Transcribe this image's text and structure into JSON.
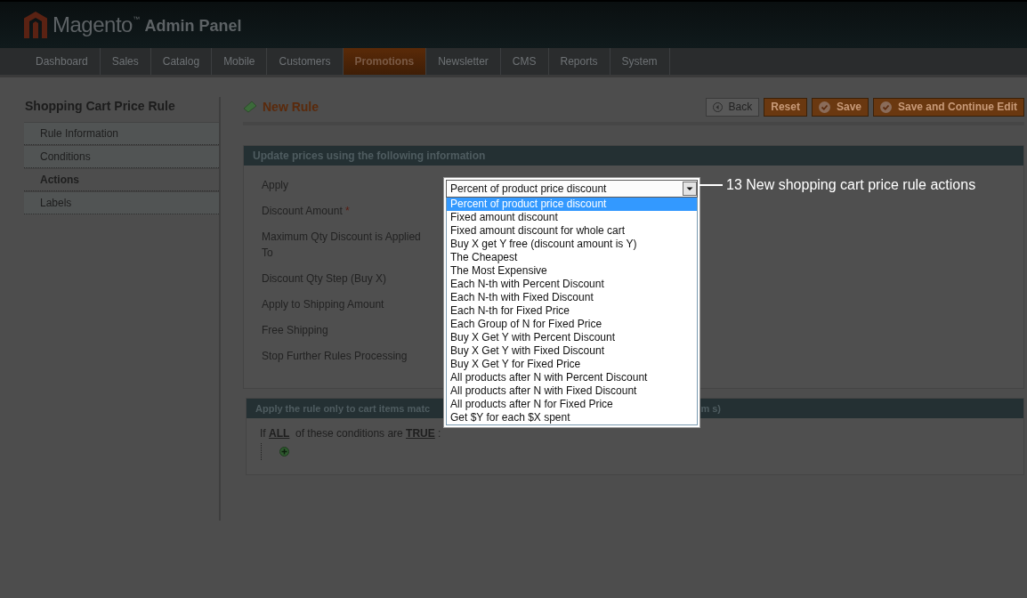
{
  "header": {
    "logo": "Magento",
    "trademark": "™",
    "subtitle": "Admin Panel"
  },
  "nav": [
    {
      "label": "Dashboard",
      "selected": false
    },
    {
      "label": "Sales",
      "selected": false
    },
    {
      "label": "Catalog",
      "selected": false
    },
    {
      "label": "Mobile",
      "selected": false
    },
    {
      "label": "Customers",
      "selected": false
    },
    {
      "label": "Promotions",
      "selected": true
    },
    {
      "label": "Newsletter",
      "selected": false
    },
    {
      "label": "CMS",
      "selected": false
    },
    {
      "label": "Reports",
      "selected": false
    },
    {
      "label": "System",
      "selected": false
    }
  ],
  "sidebar": {
    "title": "Shopping Cart Price Rule",
    "tabs": [
      {
        "label": "Rule Information",
        "selected": false
      },
      {
        "label": "Conditions",
        "selected": false
      },
      {
        "label": "Actions",
        "selected": true
      },
      {
        "label": "Labels",
        "selected": false
      }
    ]
  },
  "page_title": "New Rule",
  "buttons": [
    {
      "label": "Back",
      "kind": "back"
    },
    {
      "label": "Reset",
      "kind": "reset"
    },
    {
      "label": "Save",
      "kind": "save"
    },
    {
      "label": "Save and Continue Edit",
      "kind": "save"
    }
  ],
  "actions_section": {
    "title": "Update prices using the following information",
    "fields": [
      {
        "label": "Apply"
      },
      {
        "label": "Discount Amount",
        "required_mark": "*"
      },
      {
        "label": "Maximum Qty Discount is Applied To"
      },
      {
        "label": "Discount Qty Step (Buy X)"
      },
      {
        "label": "Apply to Shipping Amount"
      },
      {
        "label": "Free Shipping"
      },
      {
        "label": "Stop Further Rules Processing"
      }
    ],
    "apply_select": {
      "value": "Percent of product price discount",
      "expanded": true,
      "options": [
        {
          "label": "Percent of product price discount",
          "selected": true
        },
        {
          "label": "Fixed amount discount",
          "selected": false
        },
        {
          "label": "Fixed amount discount for whole cart",
          "selected": false
        },
        {
          "label": "Buy X get Y free (discount amount is Y)",
          "selected": false
        },
        {
          "label": "The Cheapest",
          "selected": false
        },
        {
          "label": "The Most Expensive",
          "selected": false
        },
        {
          "label": "Each N-th with Percent Discount",
          "selected": false
        },
        {
          "label": "Each N-th with Fixed Discount",
          "selected": false
        },
        {
          "label": "Each N-th for Fixed Price",
          "selected": false
        },
        {
          "label": "Each Group of N for Fixed Price",
          "selected": false
        },
        {
          "label": "Buy X Get Y with Percent Discount",
          "selected": false
        },
        {
          "label": "Buy X Get Y with Fixed Discount",
          "selected": false
        },
        {
          "label": "Buy X Get Y for Fixed Price",
          "selected": false
        },
        {
          "label": "All products after N with Percent Discount",
          "selected": false
        },
        {
          "label": "All products after N with Fixed Discount",
          "selected": false
        },
        {
          "label": "All products after N for Fixed Price",
          "selected": false
        },
        {
          "label": "Get $Y for each $X spent",
          "selected": false
        }
      ]
    }
  },
  "annotation": "13 New shopping cart  price rule actions",
  "conditions_section": {
    "title_start": "Apply the rule only to cart items matc",
    "title_end": "m s)",
    "sentence": {
      "prefix": "If",
      "aggregator": "ALL",
      "middle": "of these conditions are",
      "value": "TRUE",
      "suffix": ":"
    }
  }
}
